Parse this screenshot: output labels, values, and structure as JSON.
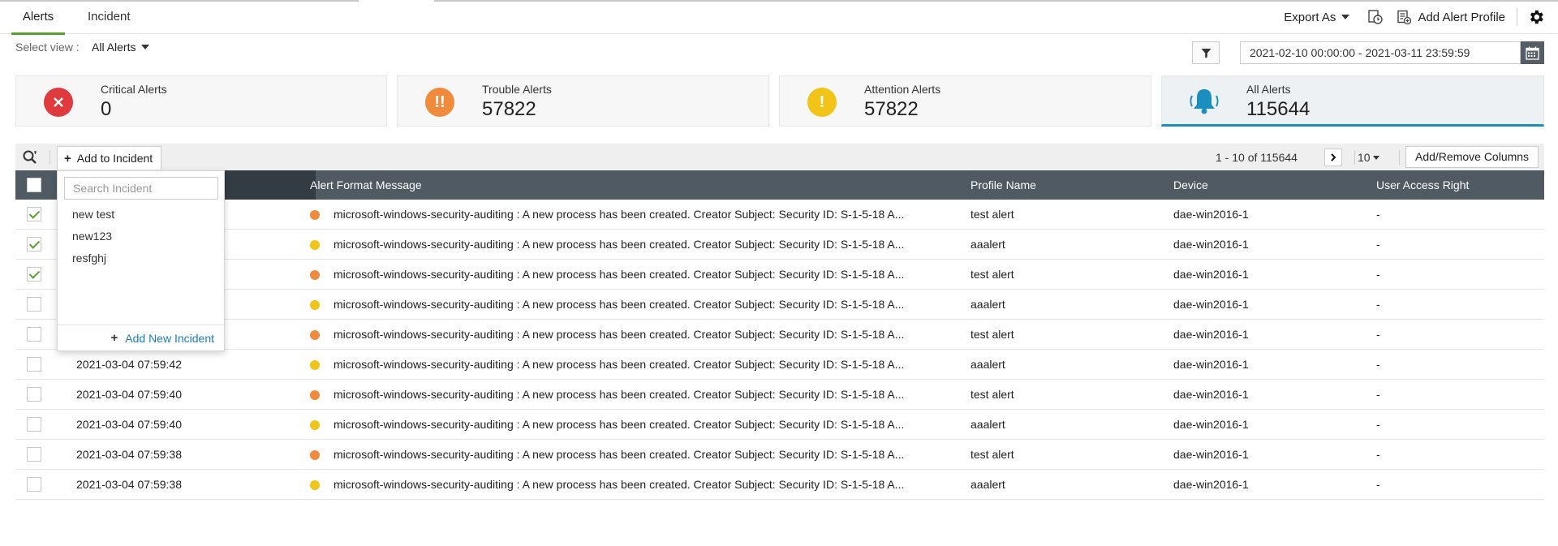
{
  "tabs": {
    "alerts": "Alerts",
    "incident": "Incident"
  },
  "header": {
    "export_label": "Export As",
    "add_profile_label": "Add Alert Profile"
  },
  "filters": {
    "select_view_label": "Select view :",
    "view_value": "All Alerts",
    "date_range": "2021-02-10 00:00:00 - 2021-03-11 23:59:59"
  },
  "summary": {
    "critical": {
      "label": "Critical Alerts",
      "count": "0",
      "color": "#e03a3e"
    },
    "trouble": {
      "label": "Trouble Alerts",
      "count": "57822",
      "color": "#f28a3c"
    },
    "attention": {
      "label": "Attention Alerts",
      "count": "57822",
      "color": "#f2c417"
    },
    "all": {
      "label": "All Alerts",
      "count": "115644",
      "color": "#1a8fbf"
    }
  },
  "toolbar": {
    "add_to_incident_label": "Add to Incident",
    "pager_text": "1 - 10 of 115644",
    "page_size": "10",
    "add_remove_columns_label": "Add/Remove Columns"
  },
  "table": {
    "columns": [
      "Alert Format Message",
      "Profile Name",
      "Device",
      "User Access Right"
    ],
    "rows": [
      {
        "time": "",
        "severity": "trouble",
        "message": "microsoft-windows-security-auditing : A new process has been created. Creator Subject: Security ID: S-1-5-18 A...",
        "profile": "test alert",
        "device": "dae-win2016-1",
        "access": "-",
        "checked": true
      },
      {
        "time": "",
        "severity": "attention",
        "message": "microsoft-windows-security-auditing : A new process has been created. Creator Subject: Security ID: S-1-5-18 A...",
        "profile": "aaalert",
        "device": "dae-win2016-1",
        "access": "-",
        "checked": true
      },
      {
        "time": "",
        "severity": "trouble",
        "message": "microsoft-windows-security-auditing : A new process has been created. Creator Subject: Security ID: S-1-5-18 A...",
        "profile": "test alert",
        "device": "dae-win2016-1",
        "access": "-",
        "checked": true
      },
      {
        "time": "",
        "severity": "attention",
        "message": "microsoft-windows-security-auditing : A new process has been created. Creator Subject: Security ID: S-1-5-18 A...",
        "profile": "aaalert",
        "device": "dae-win2016-1",
        "access": "-",
        "checked": false
      },
      {
        "time": "",
        "severity": "trouble",
        "message": "microsoft-windows-security-auditing : A new process has been created. Creator Subject: Security ID: S-1-5-18 A...",
        "profile": "test alert",
        "device": "dae-win2016-1",
        "access": "-",
        "checked": false
      },
      {
        "time": "2021-03-04 07:59:42",
        "severity": "attention",
        "message": "microsoft-windows-security-auditing : A new process has been created. Creator Subject: Security ID: S-1-5-18 A...",
        "profile": "aaalert",
        "device": "dae-win2016-1",
        "access": "-",
        "checked": false
      },
      {
        "time": "2021-03-04 07:59:40",
        "severity": "trouble",
        "message": "microsoft-windows-security-auditing : A new process has been created. Creator Subject: Security ID: S-1-5-18 A...",
        "profile": "test alert",
        "device": "dae-win2016-1",
        "access": "-",
        "checked": false
      },
      {
        "time": "2021-03-04 07:59:40",
        "severity": "attention",
        "message": "microsoft-windows-security-auditing : A new process has been created. Creator Subject: Security ID: S-1-5-18 A...",
        "profile": "aaalert",
        "device": "dae-win2016-1",
        "access": "-",
        "checked": false
      },
      {
        "time": "2021-03-04 07:59:38",
        "severity": "trouble",
        "message": "microsoft-windows-security-auditing : A new process has been created. Creator Subject: Security ID: S-1-5-18 A...",
        "profile": "test alert",
        "device": "dae-win2016-1",
        "access": "-",
        "checked": false
      },
      {
        "time": "2021-03-04 07:59:38",
        "severity": "attention",
        "message": "microsoft-windows-security-auditing : A new process has been created. Creator Subject: Security ID: S-1-5-18 A...",
        "profile": "aaalert",
        "device": "dae-win2016-1",
        "access": "-",
        "checked": false
      }
    ]
  },
  "severity_colors": {
    "trouble": "#f28a3c",
    "attention": "#f2c417"
  },
  "incident_dropdown": {
    "search_placeholder": "Search Incident",
    "items": [
      "new test",
      "new123",
      "resfghj"
    ],
    "add_new_label": "Add New Incident"
  }
}
